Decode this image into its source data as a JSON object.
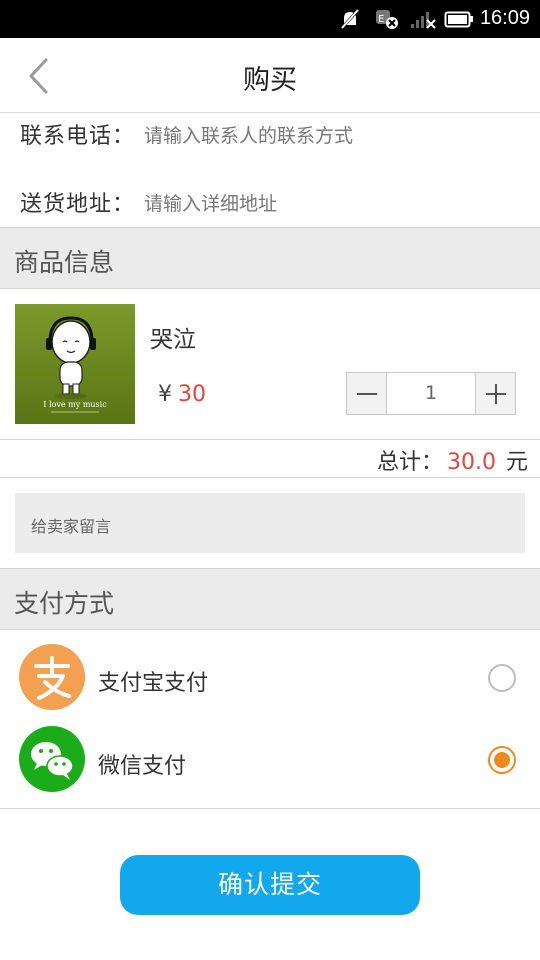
{
  "status_bar": {
    "time": "16:09"
  },
  "header": {
    "title": "购买"
  },
  "contact": {
    "phone_label": "联系电话：",
    "phone_placeholder": "请输入联系人的联系方式",
    "address_label": "送货地址：",
    "address_placeholder": "请输入详细地址"
  },
  "goods_section": {
    "title": "商品信息"
  },
  "product": {
    "name": "哭泣",
    "currency": "¥",
    "price": "30",
    "quantity": "1",
    "image_caption": "I love my music"
  },
  "total": {
    "label": "总计：",
    "value": "30.0",
    "unit": "元"
  },
  "message": {
    "placeholder": "给卖家留言"
  },
  "payment_section": {
    "title": "支付方式"
  },
  "payment": {
    "options": [
      {
        "label": "支付宝支付",
        "icon": "alipay-icon",
        "color": "#f3a151",
        "selected": false
      },
      {
        "label": "微信支付",
        "icon": "wechat-icon",
        "color": "#1aad19",
        "selected": true
      }
    ],
    "selected_color": "#f08a1c"
  },
  "submit": {
    "label": "确认提交",
    "color": "#12a8ee"
  }
}
